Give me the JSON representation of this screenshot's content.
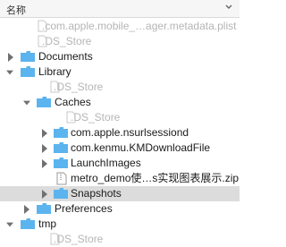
{
  "header": {
    "name_column": "名称"
  },
  "rows": [
    {
      "label": ".com.apple.mobile_…ager.metadata.plist",
      "kind": "file",
      "dim": true,
      "expander": "none"
    },
    {
      "label": ".DS_Store",
      "kind": "file",
      "dim": true,
      "expander": "none"
    },
    {
      "label": "Documents",
      "kind": "folder",
      "dim": false,
      "expander": "collapsed"
    },
    {
      "label": "Library",
      "kind": "folder",
      "dim": false,
      "expander": "expanded"
    },
    {
      "label": ".DS_Store",
      "kind": "file",
      "dim": true,
      "expander": "none"
    },
    {
      "label": "Caches",
      "kind": "folder",
      "dim": false,
      "expander": "expanded"
    },
    {
      "label": ".DS_Store",
      "kind": "file",
      "dim": true,
      "expander": "none"
    },
    {
      "label": "com.apple.nsurlsessiond",
      "kind": "folder",
      "dim": false,
      "expander": "collapsed"
    },
    {
      "label": "com.kenmu.KMDownloadFile",
      "kind": "folder",
      "dim": false,
      "expander": "collapsed"
    },
    {
      "label": "LaunchImages",
      "kind": "folder",
      "dim": false,
      "expander": "collapsed"
    },
    {
      "label": "metro_demo使…s实现图表展示.zip",
      "kind": "file",
      "dim": false,
      "expander": "none"
    },
    {
      "label": "Snapshots",
      "kind": "folder",
      "dim": false,
      "expander": "collapsed",
      "selected": true
    },
    {
      "label": "Preferences",
      "kind": "folder",
      "dim": false,
      "expander": "collapsed"
    },
    {
      "label": "tmp",
      "kind": "folder",
      "dim": false,
      "expander": "expanded"
    },
    {
      "label": ".DS_Store",
      "kind": "file",
      "dim": true,
      "expander": "none"
    }
  ],
  "colors": {
    "folder": "#5bb4ee",
    "folder_tab": "#4aa3e0",
    "selection": "#dcdcdc",
    "dim_text": "#b5b5b5"
  }
}
